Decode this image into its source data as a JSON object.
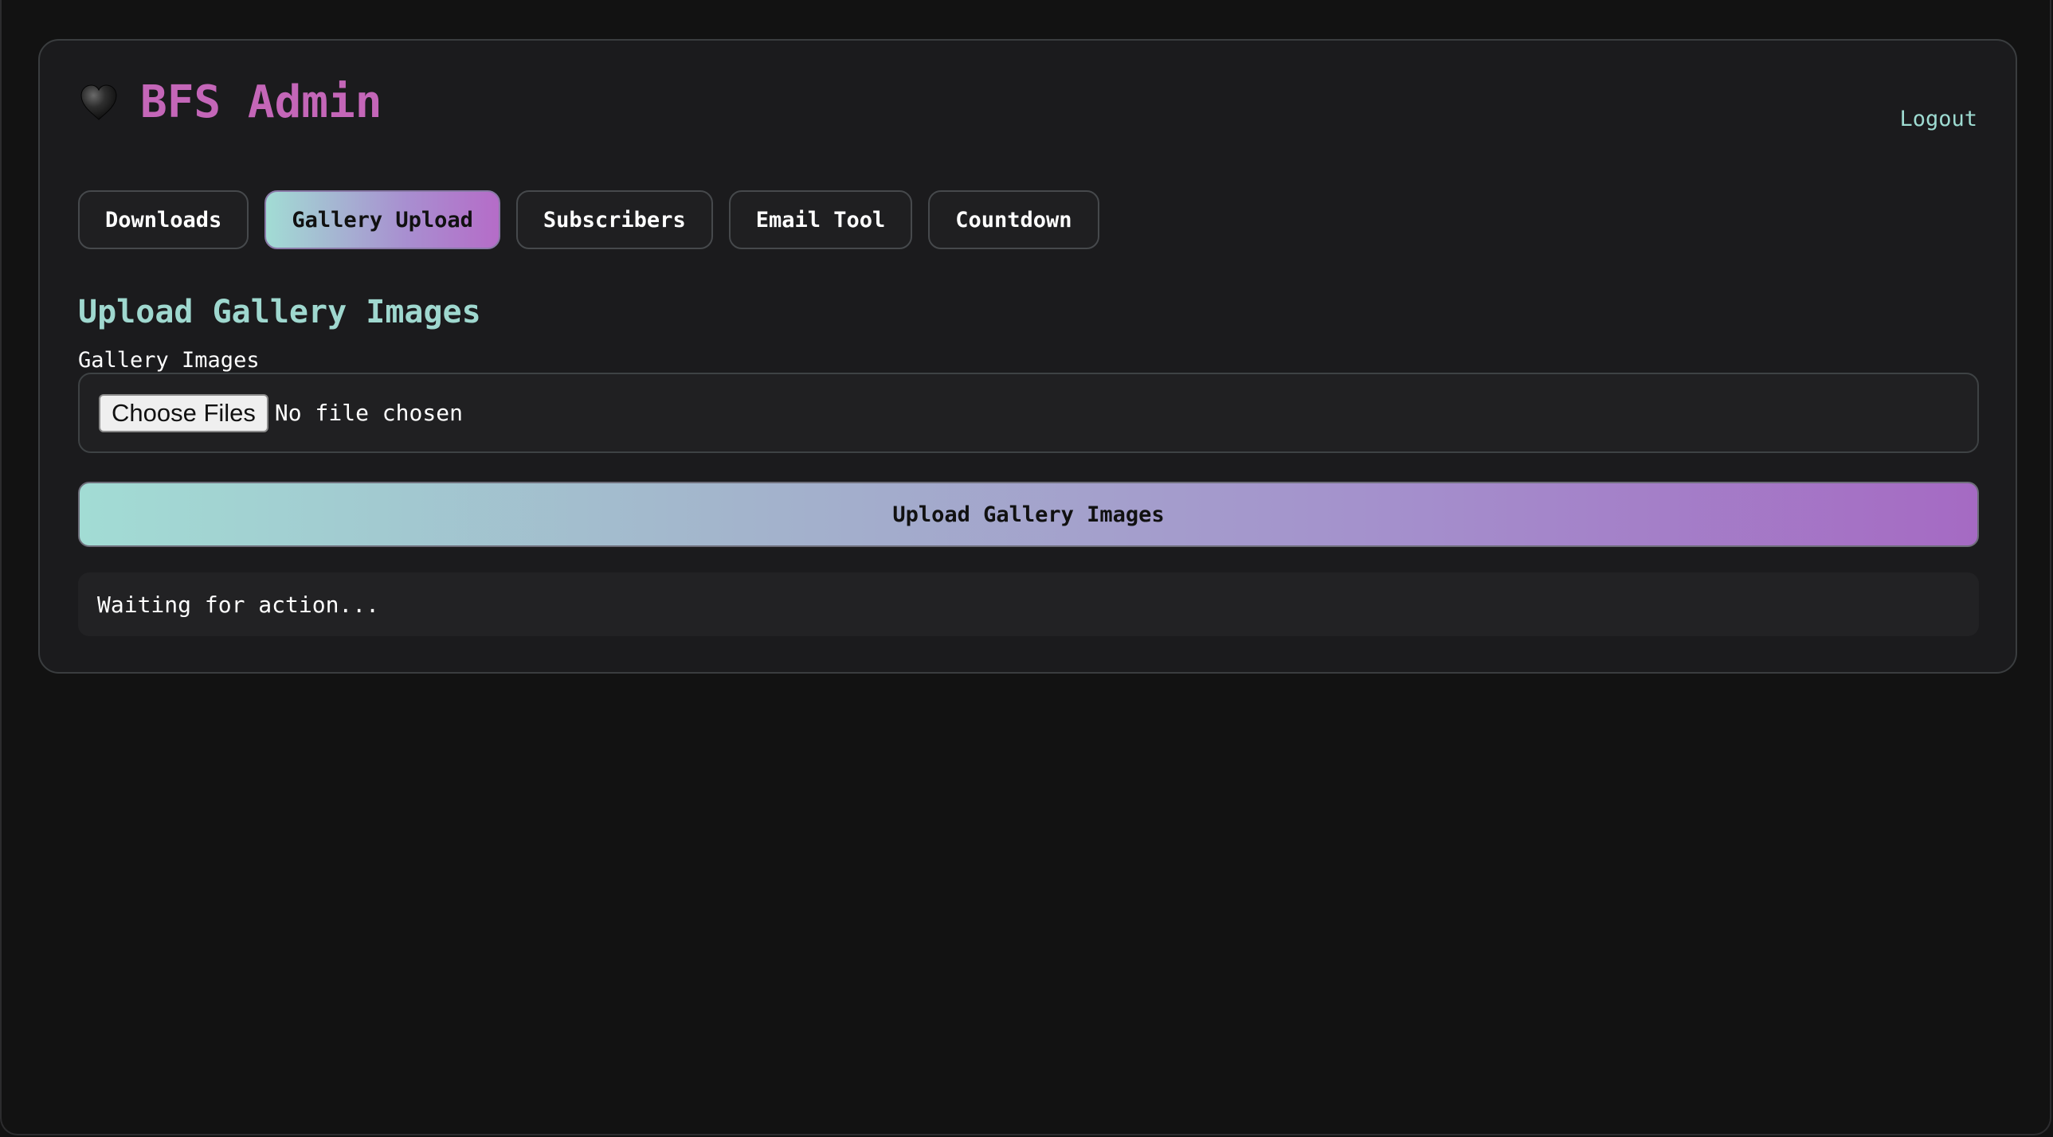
{
  "header": {
    "title": "BFS Admin",
    "brand_icon": "black-heart-icon",
    "logout_label": "Logout"
  },
  "tabs": [
    {
      "label": "Downloads",
      "active": false
    },
    {
      "label": "Gallery Upload",
      "active": true
    },
    {
      "label": "Subscribers",
      "active": false
    },
    {
      "label": "Email Tool",
      "active": false
    },
    {
      "label": "Countdown",
      "active": false
    }
  ],
  "main": {
    "section_title": "Upload Gallery Images",
    "field_label": "Gallery Images",
    "file_input": {
      "button_label": "Choose Files",
      "status": "No file chosen"
    },
    "submit_label": "Upload Gallery Images",
    "status_message": "Waiting for action..."
  },
  "colors": {
    "background": "#121212",
    "panel": "#1b1b1d",
    "brand": "#c466b8",
    "accent_teal": "#9fd8cf",
    "gradient_start": "#a2dcd4",
    "gradient_end": "#a56ac3"
  }
}
